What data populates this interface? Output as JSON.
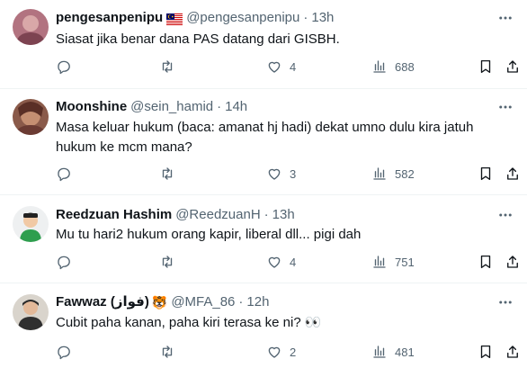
{
  "tweets": [
    {
      "name": "pengesanpenipu",
      "flag": "malaysia-flag",
      "handle": "@pengesanpenipu",
      "separator": "·",
      "time": "13h",
      "text": "Siasat jika benar dana PAS datang dari GISBH.",
      "likes": "4",
      "views": "688",
      "avatar_color": "#a8636b"
    },
    {
      "name": "Moonshine",
      "handle": "@sein_hamid",
      "separator": "·",
      "time": "14h",
      "text": "Masa keluar hukum (baca: amanat hj hadi) dekat umno dulu kira jatuh hukum ke mcm mana?",
      "likes": "3",
      "views": "582",
      "avatar_color": "#7a4a3e"
    },
    {
      "name": "Reedzuan Hashim",
      "handle": "@ReedzuanH",
      "separator": "·",
      "time": "13h",
      "text": "Mu tu hari2 hukum orang kapir, liberal dll... pigi dah",
      "likes": "4",
      "views": "751",
      "avatar_color": "#2e9e4e"
    },
    {
      "name": "Fawwaz (فواز)",
      "name_emoji": "🐯",
      "handle": "@MFA_86",
      "separator": "·",
      "time": "12h",
      "text": "Cubit paha kanan, paha kiri terasa ke ni? 👀",
      "likes": "2",
      "views": "481",
      "avatar_color": "#3a3a3a"
    }
  ],
  "icons": {
    "reply": "reply-icon",
    "retweet": "retweet-icon",
    "like": "heart-icon",
    "views": "views-icon",
    "bookmark": "bookmark-icon",
    "share": "share-icon",
    "more": "more-icon"
  }
}
